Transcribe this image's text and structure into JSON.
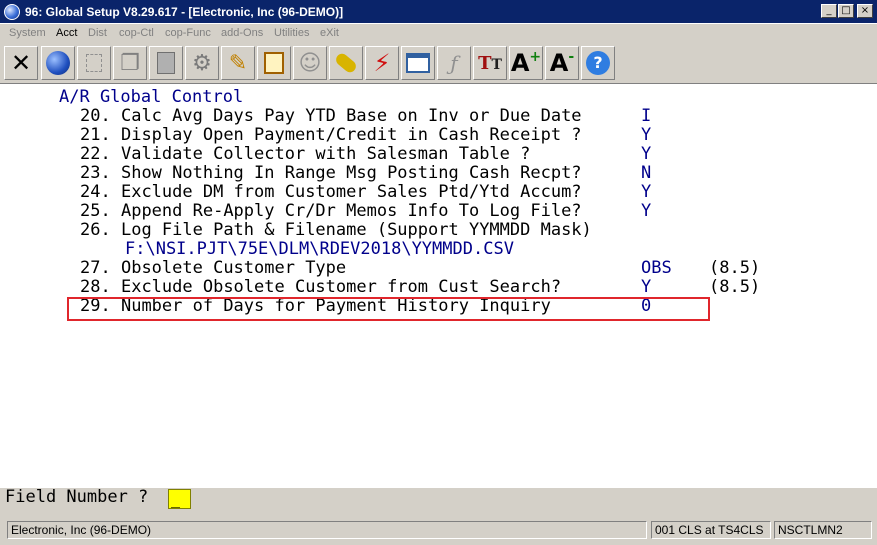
{
  "window": {
    "title": "96: Global Setup V8.29.617 - [Electronic, Inc (96-DEMO)]",
    "minimize": "_",
    "maximize": "□",
    "close": "×"
  },
  "menu": [
    {
      "label": "System"
    },
    {
      "label": "Acct"
    },
    {
      "label": "Dist"
    },
    {
      "label": "cop-Ctl"
    },
    {
      "label": "cop-Func"
    },
    {
      "label": "add-Ons"
    },
    {
      "label": "Utilities"
    },
    {
      "label": "eXit"
    }
  ],
  "toolbar": [
    {
      "icon": "exit-x-icon",
      "glyph": "✕",
      "color": "#000000"
    },
    {
      "icon": "globe-icon",
      "glyph": "●",
      "color": "#1f4fbf"
    },
    {
      "icon": "blank-page-icon",
      "glyph": "▢",
      "color": "#808080"
    },
    {
      "icon": "copy-icon",
      "glyph": "❐",
      "color": "#808080"
    },
    {
      "icon": "paste-icon",
      "glyph": "📋",
      "color": "#808080"
    },
    {
      "icon": "settings-gear-icon",
      "glyph": "⚙",
      "color": "#808080"
    },
    {
      "icon": "edit-pencil-icon",
      "glyph": "✎",
      "color": "#c08000"
    },
    {
      "icon": "notepad-icon",
      "glyph": "▤",
      "color": "#a06000"
    },
    {
      "icon": "users-icon",
      "glyph": "☺",
      "color": "#808080"
    },
    {
      "icon": "link-chain-icon",
      "glyph": "⛓",
      "color": "#c8a000"
    },
    {
      "icon": "lightning-icon",
      "glyph": "⚡",
      "color": "#d01010"
    },
    {
      "icon": "window-lightning-icon",
      "glyph": "▣",
      "color": "#3060a0"
    },
    {
      "icon": "font-script-icon",
      "glyph": "ƒ",
      "color": "#808080"
    },
    {
      "icon": "font-tt-icon",
      "glyph": "TT",
      "color": "#a01010"
    },
    {
      "icon": "font-increase-icon",
      "glyph": "A⁺",
      "color": "#000000"
    },
    {
      "icon": "font-decrease-icon",
      "glyph": "A⁻",
      "color": "#000000"
    },
    {
      "icon": "help-icon",
      "glyph": "?",
      "color": "#ffffff"
    }
  ],
  "screen": {
    "heading": "A/R Global Control",
    "lines": [
      {
        "num": "20.",
        "label": "Calc Avg Days Pay YTD Base on Inv or Due Date",
        "value": "I",
        "version": ""
      },
      {
        "num": "21.",
        "label": "Display Open Payment/Credit in Cash Receipt ?",
        "value": "Y",
        "version": ""
      },
      {
        "num": "22.",
        "label": "Validate Collector with Salesman Table ?",
        "value": "Y",
        "version": ""
      },
      {
        "num": "23.",
        "label": "Show Nothing In Range Msg Posting Cash Recpt?",
        "value": "N",
        "version": ""
      },
      {
        "num": "24.",
        "label": "Exclude DM from Customer Sales Ptd/Ytd Accum?",
        "value": "Y",
        "version": ""
      },
      {
        "num": "25.",
        "label": "Append Re-Apply Cr/Dr Memos Info To Log File?",
        "value": "Y",
        "version": ""
      },
      {
        "num": "26.",
        "label": "Log File Path & Filename (Support YYMMDD Mask)",
        "value": "",
        "version": ""
      },
      {
        "num": "27.",
        "label": "Obsolete Customer Type",
        "value": "OBS",
        "version": "(8.5)"
      },
      {
        "num": "28.",
        "label": "Exclude Obsolete Customer from Cust Search?",
        "value": "Y",
        "version": "(8.5)"
      },
      {
        "num": "29.",
        "label": "Number of Days for Payment History Inquiry",
        "value": "0",
        "version": ""
      }
    ],
    "log_path": "F:\\NSI.PJT\\75E\\DLM\\RDEV2018\\YYMMDD.CSV"
  },
  "prompt": {
    "label": "Field Number ?",
    "value": "_"
  },
  "status": {
    "company": "Electronic, Inc (96-DEMO)",
    "session": "001 CLS at TS4CLS",
    "user": "NSCTLMN2"
  },
  "colors": {
    "titlebar": "#0a246a",
    "value_text": "#00008b",
    "highlight": "#e0262c",
    "prompt_input": "#ffff00"
  }
}
